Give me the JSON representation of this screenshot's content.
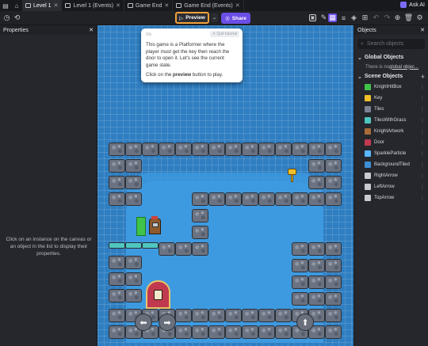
{
  "tabs": [
    {
      "label": "Level 1",
      "active": true
    },
    {
      "label": "Level 1 (Events)",
      "active": false
    },
    {
      "label": "Game End",
      "active": false
    },
    {
      "label": "Game End (Events)",
      "active": false
    }
  ],
  "ask_ai_label": "Ask AI",
  "toolbar": {
    "preview_label": "Preview",
    "share_label": "Share"
  },
  "properties": {
    "title": "Properties",
    "empty_message": "Click on an instance on the canvas or an object in the list to display their properties."
  },
  "tooltip": {
    "progress": "0%",
    "quit_label": "Quit tutorial",
    "text1": "This game is a Platformer where the player must get the key then reach the door to open it. Let's see the current game state.",
    "text2_pre": "Click on the ",
    "text2_bold": "preview",
    "text2_post": " button to play."
  },
  "objects_panel": {
    "title": "Objects",
    "search_placeholder": "Search objects",
    "global_title": "Global Objects",
    "no_global_pre": "There is no ",
    "no_global_link": "global objec...",
    "scene_title": "Scene Objects",
    "items": [
      {
        "name": "KnightHitBox",
        "color": "#3fc34a"
      },
      {
        "name": "Key",
        "color": "#f0c02a"
      },
      {
        "name": "Tiles",
        "color": "#7b8392"
      },
      {
        "name": "TilesWithGrass",
        "color": "#4fc6c0"
      },
      {
        "name": "KnightArtwork",
        "color": "#a86a3a"
      },
      {
        "name": "Door",
        "color": "#c0394e"
      },
      {
        "name": "SparkleParticle",
        "color": "#5ab7ff"
      },
      {
        "name": "BackgroundTiled",
        "color": "#3d8fd6"
      },
      {
        "name": "RightArrow",
        "color": "#c8ccd2"
      },
      {
        "name": "LeftArrow",
        "color": "#c8ccd2"
      },
      {
        "name": "TopArrow",
        "color": "#c8ccd2"
      }
    ]
  },
  "colors": {
    "accent": "#6b4ee6",
    "preview_highlight": "#f0a23a",
    "canvas_bg": "#2f7ec1"
  }
}
